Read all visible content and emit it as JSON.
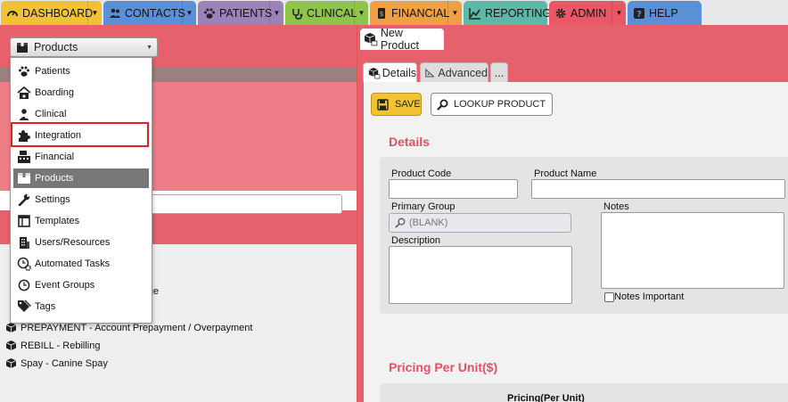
{
  "nav": {
    "dashboard": "DASHBOARD",
    "contacts": "CONTACTS",
    "patients": "PATIENTS",
    "clinical": "CLINICAL",
    "financial": "FINANCIAL",
    "reporting": "REPORTING",
    "admin": "ADMIN",
    "help": "HELP"
  },
  "category_select": {
    "value": "Products"
  },
  "menu": {
    "items": [
      {
        "label": "Patients",
        "icon": "paw-icon"
      },
      {
        "label": "Boarding",
        "icon": "house-paw-icon"
      },
      {
        "label": "Clinical",
        "icon": "doctor-icon"
      },
      {
        "label": "Integration",
        "icon": "puzzle-icon"
      },
      {
        "label": "Financial",
        "icon": "cash-register-icon"
      },
      {
        "label": "Products",
        "icon": "box-icon"
      },
      {
        "label": "Settings",
        "icon": "wrench-icon"
      },
      {
        "label": "Templates",
        "icon": "template-icon"
      },
      {
        "label": "Users/Resources",
        "icon": "building-icon"
      },
      {
        "label": "Automated Tasks",
        "icon": "clock-gear-icon"
      },
      {
        "label": "Event Groups",
        "icon": "clock-icon"
      },
      {
        "label": "Tags",
        "icon": "tags-icon"
      }
    ],
    "selected": "Products",
    "highlighted": "Integration"
  },
  "product_list": {
    "partial_item": "Charge",
    "items": [
      "PREPAYMENT - Account Prepayment / Overpayment",
      "REBILL - Rebilling",
      "Spay - Canine Spay"
    ]
  },
  "doc_tab": "New Product",
  "subtabs": {
    "details": "Details",
    "advanced": "Advanced",
    "more": "..."
  },
  "toolbar": {
    "save": "SAVE",
    "lookup": "LOOKUP PRODUCT"
  },
  "details": {
    "title": "Details",
    "product_code_label": "Product Code",
    "product_code": "",
    "product_name_label": "Product Name",
    "product_name": "",
    "primary_group_label": "Primary Group",
    "primary_group_value": "(BLANK)",
    "notes_label": "Notes",
    "description_label": "Description",
    "notes_important_label": "Notes Important"
  },
  "pricing": {
    "title": "Pricing Per Unit($)",
    "column": "Pricing(Per Unit)"
  },
  "colors": {
    "accent": "#e6606e",
    "section_title": "#e05363",
    "save_button": "#f1c232",
    "highlight_border": "#e02020"
  }
}
